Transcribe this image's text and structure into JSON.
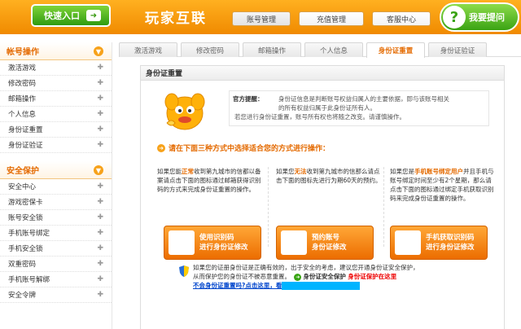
{
  "header": {
    "quick_entry": "快速入口",
    "brand": "玩家互联",
    "nav": [
      "账号管理",
      "充值管理",
      "客服中心"
    ],
    "ask": "我要提问"
  },
  "sidebar": {
    "sections": [
      {
        "title": "帐号操作",
        "items": [
          "激活游戏",
          "修改密码",
          "邮箱操作",
          "个人信息",
          "身份证重置",
          "身份证验证"
        ]
      },
      {
        "title": "安全保护",
        "items": [
          "安全中心",
          "游戏密保卡",
          "账号安全锁",
          "手机账号绑定",
          "手机安全锁",
          "双重密码",
          "手机账号解绑",
          "安全令牌"
        ]
      }
    ]
  },
  "tabs": [
    "激活游戏",
    "修改密码",
    "邮箱操作",
    "个人信息",
    "身份证重置",
    "身份证验证"
  ],
  "panel": {
    "title": "身份证重置",
    "notice_label": "官方提醒：",
    "notice_line1": "身份证信息是判断账号权益归属人的主要依据，即与该账号相关",
    "notice_line2": "的所有权益归属于此身份证所有人。",
    "notice_line3": "若您进行身份证重置，账号所有权也将随之改变。请谨慎操作。",
    "prompt": "请在下面三种方式中选择适合您的方式进行操作：",
    "col1_a": "如果您能",
    "col1_hl": "正常",
    "col1_b": "收到第九城市的信都以备案请点击下面的图标通过邮箱获得识别码的方式来完成身份证重置的操作。",
    "col2_a": "如果您",
    "col2_hl": "无法",
    "col2_b": "收到第九城市的信那么请点击下面的图标先进行为期60天的预约。",
    "col3_a": "如果您是",
    "col3_hl": "手机账号绑定用户",
    "col3_b": "并且手机与账号绑定时间至少有2个星期，那么请点击下面的图标通过绑定手机获取识别码来完成身份证重置的操作。",
    "btn1": "使用识别码\n进行身份证修改",
    "btn2": "预约账号\n身份证修改",
    "btn3": "手机获取识别码\n进行身份证修改",
    "foot1": "如果您的证册身份证是正确有效的，出于安全的考虑，建议您开通身份证安全保护，",
    "foot2": "从而保护您的身份证不被恶意重置。",
    "foot_safe": "身份证安全保护",
    "foot_red": "身份证保护在这里",
    "foot_link": "不会身份证重置吗?点击这里，看"
  }
}
